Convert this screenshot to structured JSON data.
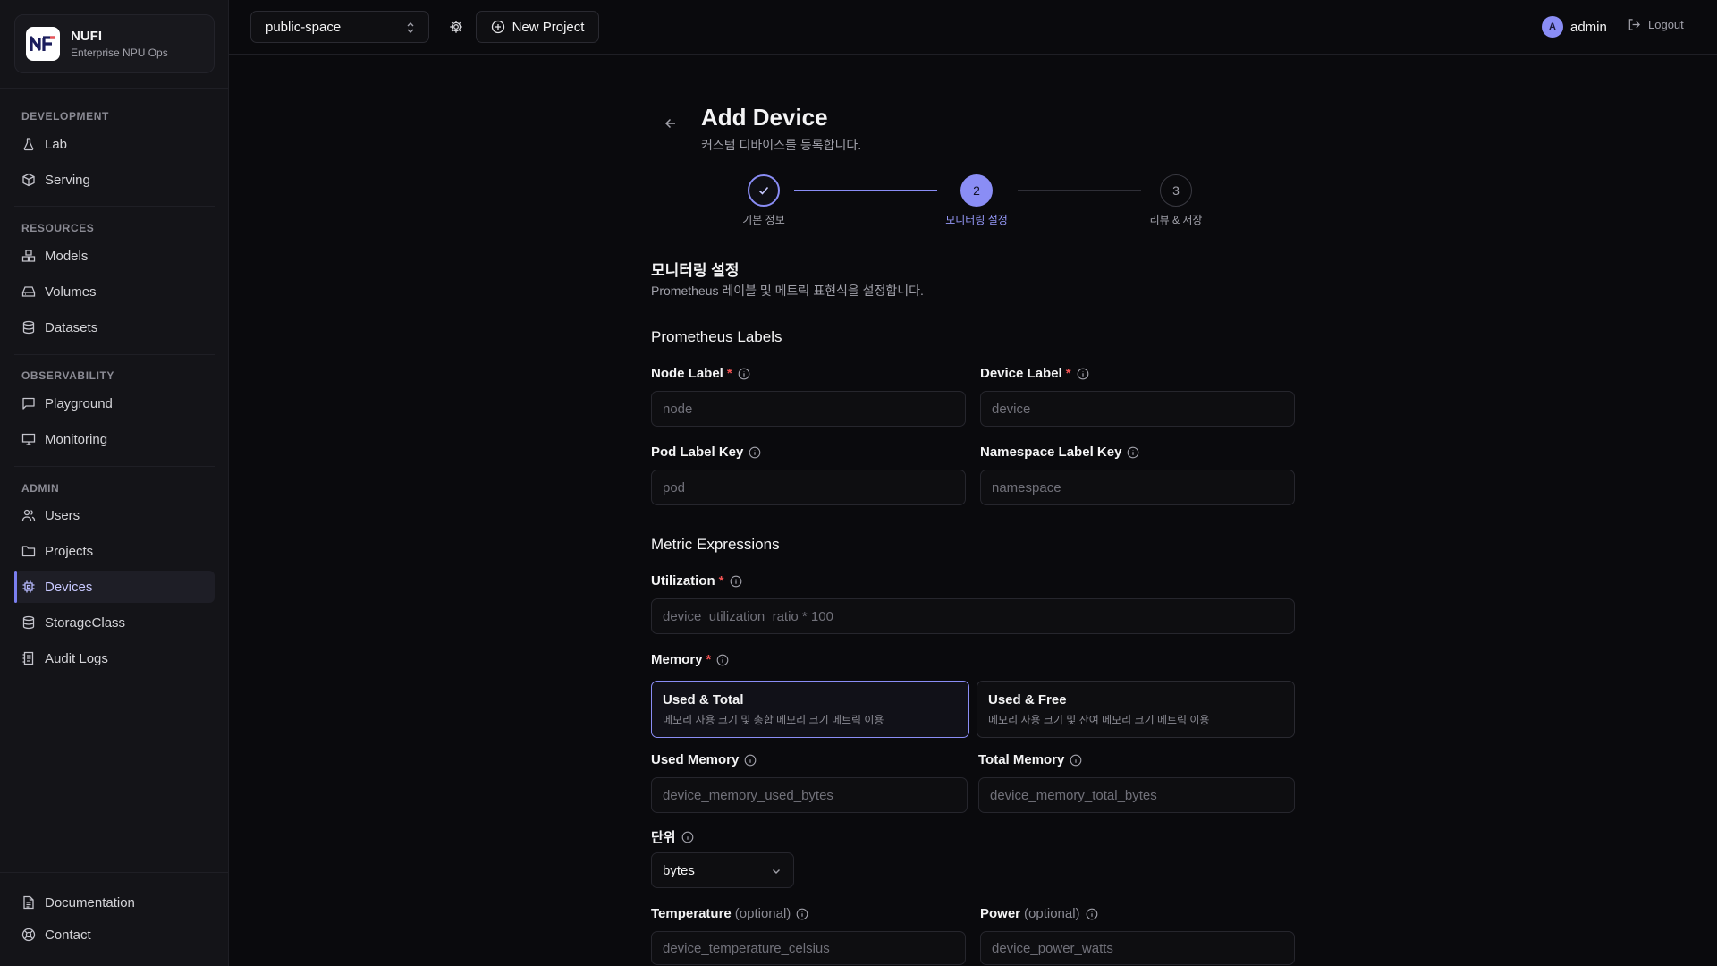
{
  "brand": {
    "name": "NUFI",
    "subtitle": "Enterprise NPU Ops"
  },
  "sidebar": {
    "sections": [
      {
        "title": "DEVELOPMENT",
        "items": [
          {
            "label": "Lab",
            "icon": "flask-icon"
          },
          {
            "label": "Serving",
            "icon": "package-icon"
          }
        ]
      },
      {
        "title": "RESOURCES",
        "items": [
          {
            "label": "Models",
            "icon": "boxes-icon"
          },
          {
            "label": "Volumes",
            "icon": "hard-drive-icon"
          },
          {
            "label": "Datasets",
            "icon": "database-icon"
          }
        ]
      },
      {
        "title": "OBSERVABILITY",
        "items": [
          {
            "label": "Playground",
            "icon": "chat-icon"
          },
          {
            "label": "Monitoring",
            "icon": "monitor-icon"
          }
        ]
      },
      {
        "title": "ADMIN",
        "items": [
          {
            "label": "Users",
            "icon": "users-icon"
          },
          {
            "label": "Projects",
            "icon": "folder-icon"
          },
          {
            "label": "Devices",
            "icon": "chip-icon"
          },
          {
            "label": "StorageClass",
            "icon": "database-icon"
          },
          {
            "label": "Audit Logs",
            "icon": "audit-log-icon"
          }
        ]
      }
    ],
    "footer": [
      {
        "label": "Documentation",
        "icon": "document-icon"
      },
      {
        "label": "Contact",
        "icon": "lifebuoy-icon"
      }
    ],
    "active": "Devices"
  },
  "header": {
    "project": "public-space",
    "new_project": "New Project",
    "user_initial": "A",
    "user_name": "admin",
    "logout": "Logout"
  },
  "page": {
    "title": "Add Device",
    "subtitle": "커스텀 디바이스를 등록합니다."
  },
  "steps": [
    {
      "number": "1",
      "label": "기본 정보",
      "state": "done"
    },
    {
      "number": "2",
      "label": "모니터링 설정",
      "state": "current"
    },
    {
      "number": "3",
      "label": "리뷰 & 저장",
      "state": "todo"
    }
  ],
  "section": {
    "title": "모니터링 설정",
    "description": "Prometheus 레이블 및 메트릭 표현식을 설정합니다."
  },
  "labels_group": {
    "title": "Prometheus Labels",
    "node_label": {
      "label": "Node Label",
      "required": "*",
      "placeholder": "node"
    },
    "device_label": {
      "label": "Device Label",
      "required": "*",
      "placeholder": "device"
    },
    "pod_label_key": {
      "label": "Pod Label Key",
      "placeholder": "pod"
    },
    "namespace_label_key": {
      "label": "Namespace Label Key",
      "placeholder": "namespace"
    }
  },
  "metrics_group": {
    "title": "Metric Expressions",
    "utilization": {
      "label": "Utilization",
      "required": "*",
      "placeholder": "device_utilization_ratio * 100"
    },
    "memory": {
      "label": "Memory",
      "required": "*",
      "options": [
        {
          "title": "Used & Total",
          "desc": "메모리 사용 크기 및 총합 메모리 크기 메트릭 이용",
          "selected": true
        },
        {
          "title": "Used & Free",
          "desc": "메모리 사용 크기 및 잔여 메모리 크기 메트릭 이용",
          "selected": false
        }
      ]
    },
    "used_memory": {
      "label": "Used Memory",
      "placeholder": "device_memory_used_bytes"
    },
    "total_memory": {
      "label": "Total Memory",
      "placeholder": "device_memory_total_bytes"
    },
    "unit": {
      "label": "단위",
      "value": "bytes"
    },
    "temperature": {
      "label": "Temperature",
      "optional": "(optional)",
      "placeholder": "device_temperature_celsius"
    },
    "power": {
      "label": "Power",
      "optional": "(optional)",
      "placeholder": "device_power_watts"
    }
  },
  "colors": {
    "accent": "#8a8df5",
    "background": "#0a0a0d",
    "sidebar": "#141418",
    "required": "#f05252"
  }
}
